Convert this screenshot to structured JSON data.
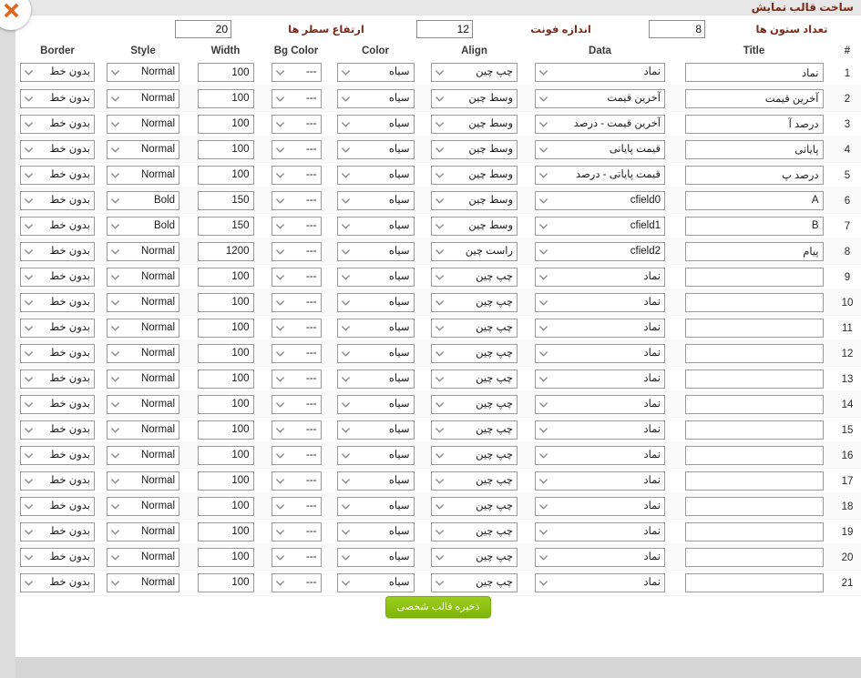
{
  "window": {
    "title": "ساخت قالب نمایش",
    "close_icon": "close-x-icon"
  },
  "settings": [
    {
      "label": "تعداد ستون ها",
      "value": "8",
      "name": "column-count"
    },
    {
      "label": "اندازه فونت",
      "value": "12",
      "name": "font-size"
    },
    {
      "label": "ارتفاع سطر ها",
      "value": "20",
      "name": "row-height"
    }
  ],
  "table": {
    "headers": {
      "num": "#",
      "title": "Title",
      "data": "Data",
      "align": "Align",
      "color": "Color",
      "bg_color": "Bg Color",
      "width": "Width",
      "style": "Style",
      "border": "Border"
    },
    "rows": [
      {
        "num": "1",
        "title": "نماد",
        "data": "نماد",
        "align": "چپ چین",
        "color": "سیاه",
        "bg_color": "---",
        "width": "100",
        "style": "Normal",
        "border": "بدون خط"
      },
      {
        "num": "2",
        "title": "آخرین قیمت",
        "data": "آخرین قیمت",
        "align": "وسط چین",
        "color": "سیاه",
        "bg_color": "---",
        "width": "100",
        "style": "Normal",
        "border": "بدون خط"
      },
      {
        "num": "3",
        "title": "درصد آ",
        "data": "آخرین قیمت - درصد",
        "align": "وسط چین",
        "color": "سیاه",
        "bg_color": "---",
        "width": "100",
        "style": "Normal",
        "border": "بدون خط"
      },
      {
        "num": "4",
        "title": "پایانی",
        "data": "قیمت پایانی",
        "align": "وسط چین",
        "color": "سیاه",
        "bg_color": "---",
        "width": "100",
        "style": "Normal",
        "border": "بدون خط"
      },
      {
        "num": "5",
        "title": "درصد پ",
        "data": "قیمت پایانی - درصد",
        "align": "وسط چین",
        "color": "سیاه",
        "bg_color": "---",
        "width": "100",
        "style": "Normal",
        "border": "بدون خط"
      },
      {
        "num": "6",
        "title": "A",
        "data": "cfield0",
        "align": "وسط چین",
        "color": "سیاه",
        "bg_color": "---",
        "width": "150",
        "style": "Bold",
        "border": "بدون خط"
      },
      {
        "num": "7",
        "title": "B",
        "data": "cfield1",
        "align": "وسط چین",
        "color": "سیاه",
        "bg_color": "---",
        "width": "150",
        "style": "Bold",
        "border": "بدون خط"
      },
      {
        "num": "8",
        "title": "پیام",
        "data": "cfield2",
        "align": "راست چین",
        "color": "سیاه",
        "bg_color": "---",
        "width": "1200",
        "style": "Normal",
        "border": "بدون خط"
      },
      {
        "num": "9",
        "title": "",
        "data": "نماد",
        "align": "چپ چین",
        "color": "سیاه",
        "bg_color": "---",
        "width": "100",
        "style": "Normal",
        "border": "بدون خط"
      },
      {
        "num": "10",
        "title": "",
        "data": "نماد",
        "align": "چپ چین",
        "color": "سیاه",
        "bg_color": "---",
        "width": "100",
        "style": "Normal",
        "border": "بدون خط"
      },
      {
        "num": "11",
        "title": "",
        "data": "نماد",
        "align": "چپ چین",
        "color": "سیاه",
        "bg_color": "---",
        "width": "100",
        "style": "Normal",
        "border": "بدون خط"
      },
      {
        "num": "12",
        "title": "",
        "data": "نماد",
        "align": "چپ چین",
        "color": "سیاه",
        "bg_color": "---",
        "width": "100",
        "style": "Normal",
        "border": "بدون خط"
      },
      {
        "num": "13",
        "title": "",
        "data": "نماد",
        "align": "چپ چین",
        "color": "سیاه",
        "bg_color": "---",
        "width": "100",
        "style": "Normal",
        "border": "بدون خط"
      },
      {
        "num": "14",
        "title": "",
        "data": "نماد",
        "align": "چپ چین",
        "color": "سیاه",
        "bg_color": "---",
        "width": "100",
        "style": "Normal",
        "border": "بدون خط"
      },
      {
        "num": "15",
        "title": "",
        "data": "نماد",
        "align": "چپ چین",
        "color": "سیاه",
        "bg_color": "---",
        "width": "100",
        "style": "Normal",
        "border": "بدون خط"
      },
      {
        "num": "16",
        "title": "",
        "data": "نماد",
        "align": "چپ چین",
        "color": "سیاه",
        "bg_color": "---",
        "width": "100",
        "style": "Normal",
        "border": "بدون خط"
      },
      {
        "num": "17",
        "title": "",
        "data": "نماد",
        "align": "چپ چین",
        "color": "سیاه",
        "bg_color": "---",
        "width": "100",
        "style": "Normal",
        "border": "بدون خط"
      },
      {
        "num": "18",
        "title": "",
        "data": "نماد",
        "align": "چپ چین",
        "color": "سیاه",
        "bg_color": "---",
        "width": "100",
        "style": "Normal",
        "border": "بدون خط"
      },
      {
        "num": "19",
        "title": "",
        "data": "نماد",
        "align": "چپ چین",
        "color": "سیاه",
        "bg_color": "---",
        "width": "100",
        "style": "Normal",
        "border": "بدون خط"
      },
      {
        "num": "20",
        "title": "",
        "data": "نماد",
        "align": "چپ چین",
        "color": "سیاه",
        "bg_color": "---",
        "width": "100",
        "style": "Normal",
        "border": "بدون خط"
      },
      {
        "num": "21",
        "title": "",
        "data": "نماد",
        "align": "چپ چین",
        "color": "سیاه",
        "bg_color": "---",
        "width": "100",
        "style": "Normal",
        "border": "بدون خط"
      }
    ]
  },
  "footer": {
    "save_label": "ذخیره قالب شخصی"
  },
  "colors": {
    "title_text": "#7b2b18",
    "save_button": "#8dc012",
    "close_icon": "#e8631a",
    "page_background": "#d6d6d6",
    "panel_background": "#ffffff"
  }
}
